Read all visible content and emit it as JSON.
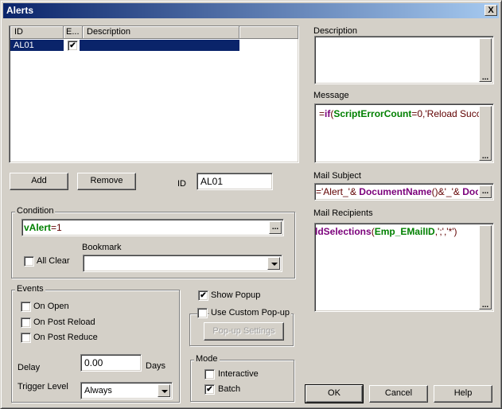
{
  "window": {
    "title": "Alerts",
    "close_label": "X"
  },
  "alerts_list": {
    "columns": [
      "ID",
      "E...",
      "Description"
    ],
    "rows": [
      {
        "id": "AL01",
        "enabled": true,
        "description": ""
      }
    ]
  },
  "buttons": {
    "add": "Add",
    "remove": "Remove",
    "ok": "OK",
    "cancel": "Cancel",
    "help": "Help",
    "popup_settings": "Pop-up Settings",
    "ellipsis": "..."
  },
  "id_field": {
    "label": "ID",
    "value": "AL01"
  },
  "condition": {
    "group_label": "Condition",
    "expression_parts": [
      {
        "text": "vAlert",
        "type": "field"
      },
      {
        "text": "=1",
        "type": "text"
      }
    ],
    "all_clear_label": "All Clear",
    "all_clear_checked": false,
    "bookmark_label": "Bookmark",
    "bookmark_value": ""
  },
  "events": {
    "group_label": "Events",
    "on_open": {
      "label": "On Open",
      "checked": false
    },
    "on_post_reload": {
      "label": "On Post Reload",
      "checked": false
    },
    "on_post_reduce": {
      "label": "On Post Reduce",
      "checked": false
    },
    "delay_label": "Delay",
    "delay_value": "0.00",
    "delay_unit": "Days",
    "trigger_level_label": "Trigger Level",
    "trigger_level_value": "Always"
  },
  "popup": {
    "show_popup_label": "Show Popup",
    "show_popup_checked": true,
    "use_custom_label": "Use Custom Pop-up",
    "use_custom_checked": false
  },
  "mode": {
    "group_label": "Mode",
    "interactive": {
      "label": "Interactive",
      "checked": false
    },
    "batch": {
      "label": "Batch",
      "checked": true
    }
  },
  "right_panel": {
    "description_label": "Description",
    "description_value": "",
    "message_label": "Message",
    "message_parts": [
      {
        "text": "=",
        "type": "text"
      },
      {
        "text": "if",
        "type": "keyword"
      },
      {
        "text": "(",
        "type": "text"
      },
      {
        "text": "ScriptErrorCount",
        "type": "field"
      },
      {
        "text": "=0,'Reload Succ",
        "type": "text"
      }
    ],
    "mail_subject_label": "Mail Subject",
    "mail_subject_parts": [
      {
        "text": "='Alert_'& ",
        "type": "text"
      },
      {
        "text": "DocumentName",
        "type": "keyword"
      },
      {
        "text": "()&'_'& ",
        "type": "text"
      },
      {
        "text": "Docu",
        "type": "keyword"
      }
    ],
    "mail_recipients_label": "Mail Recipients",
    "mail_recipients_parts": [
      {
        "text": "ldSelections",
        "type": "keyword"
      },
      {
        "text": "(",
        "type": "text"
      },
      {
        "text": "Emp_EMailID",
        "type": "field"
      },
      {
        "text": ",';','*')",
        "type": "text"
      }
    ]
  },
  "check_glyph": "✔"
}
